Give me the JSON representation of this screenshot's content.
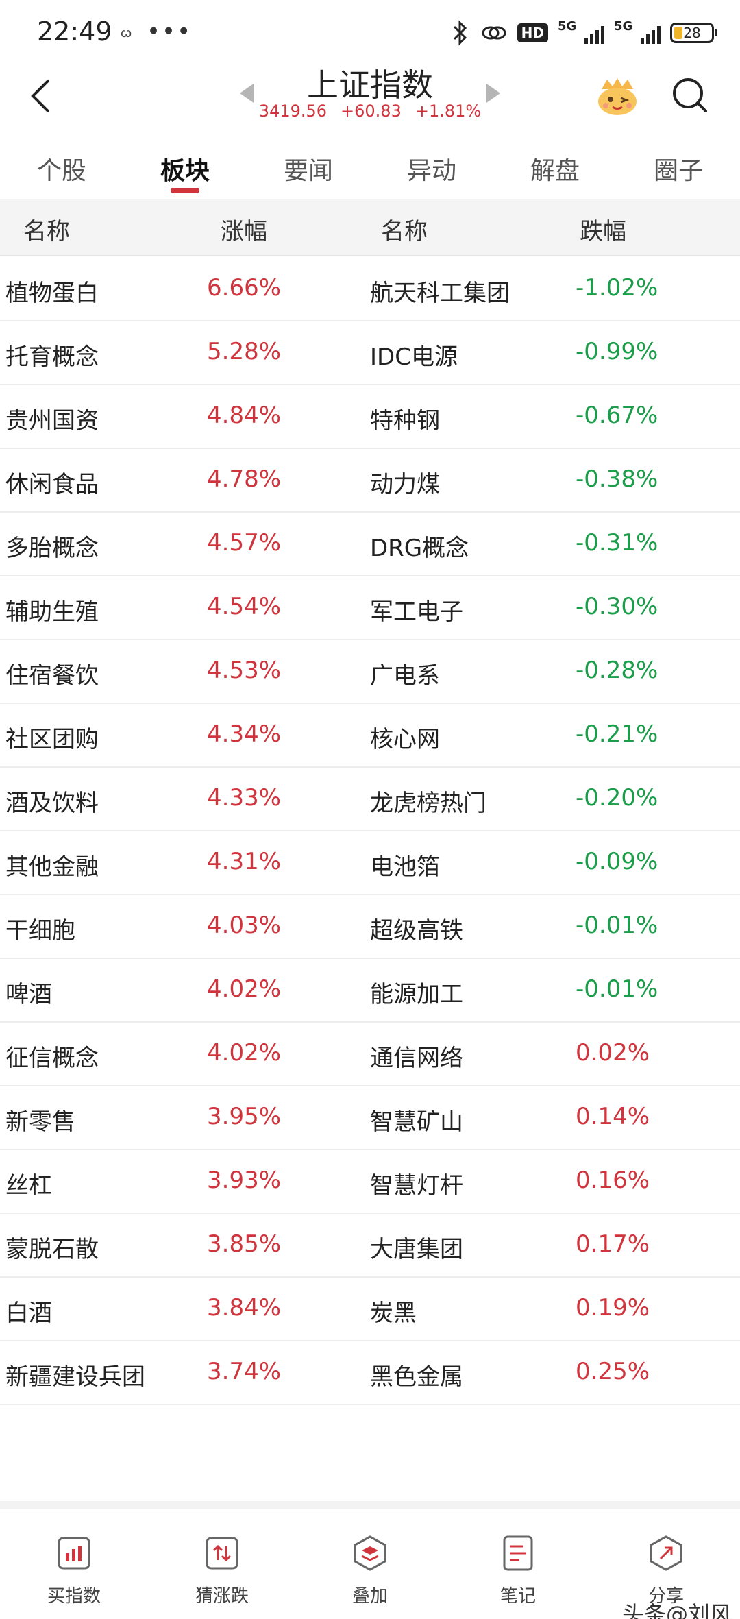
{
  "status_bar": {
    "time": "22:49",
    "small_icon": "ꞷ",
    "dots": "•••",
    "hd": "HD",
    "net1": "5G",
    "net2": "5G",
    "battery": "28"
  },
  "header": {
    "title": "上证指数",
    "price": "3419.56",
    "change": "+60.83",
    "change_pct": "+1.81%"
  },
  "tabs": [
    {
      "label": "个股"
    },
    {
      "label": "板块"
    },
    {
      "label": "要闻"
    },
    {
      "label": "异动"
    },
    {
      "label": "解盘"
    },
    {
      "label": "圈子"
    }
  ],
  "table": {
    "col_name_left": "名称",
    "col_rise": "涨幅",
    "col_name_right": "名称",
    "col_fall": "跌幅",
    "rows": [
      {
        "left_name": "植物蛋白",
        "left_pct": "6.66%",
        "right_name": "航天科工集团",
        "right_pct": "-1.02%",
        "right_dir": "down"
      },
      {
        "left_name": "托育概念",
        "left_pct": "5.28%",
        "right_name": "IDC电源",
        "right_pct": "-0.99%",
        "right_dir": "down"
      },
      {
        "left_name": "贵州国资",
        "left_pct": "4.84%",
        "right_name": "特种钢",
        "right_pct": "-0.67%",
        "right_dir": "down"
      },
      {
        "left_name": "休闲食品",
        "left_pct": "4.78%",
        "right_name": "动力煤",
        "right_pct": "-0.38%",
        "right_dir": "down"
      },
      {
        "left_name": "多胎概念",
        "left_pct": "4.57%",
        "right_name": "DRG概念",
        "right_pct": "-0.31%",
        "right_dir": "down"
      },
      {
        "left_name": "辅助生殖",
        "left_pct": "4.54%",
        "right_name": "军工电子",
        "right_pct": "-0.30%",
        "right_dir": "down"
      },
      {
        "left_name": "住宿餐饮",
        "left_pct": "4.53%",
        "right_name": "广电系",
        "right_pct": "-0.28%",
        "right_dir": "down"
      },
      {
        "left_name": "社区团购",
        "left_pct": "4.34%",
        "right_name": "核心网",
        "right_pct": "-0.21%",
        "right_dir": "down"
      },
      {
        "left_name": "酒及饮料",
        "left_pct": "4.33%",
        "right_name": "龙虎榜热门",
        "right_pct": "-0.20%",
        "right_dir": "down"
      },
      {
        "left_name": "其他金融",
        "left_pct": "4.31%",
        "right_name": "电池箔",
        "right_pct": "-0.09%",
        "right_dir": "down"
      },
      {
        "left_name": "干细胞",
        "left_pct": "4.03%",
        "right_name": "超级高铁",
        "right_pct": "-0.01%",
        "right_dir": "down"
      },
      {
        "left_name": "啤酒",
        "left_pct": "4.02%",
        "right_name": "能源加工",
        "right_pct": "-0.01%",
        "right_dir": "down"
      },
      {
        "left_name": "征信概念",
        "left_pct": "4.02%",
        "right_name": "通信网络",
        "right_pct": "0.02%",
        "right_dir": "up"
      },
      {
        "left_name": "新零售",
        "left_pct": "3.95%",
        "right_name": "智慧矿山",
        "right_pct": "0.14%",
        "right_dir": "up"
      },
      {
        "left_name": "丝杠",
        "left_pct": "3.93%",
        "right_name": "智慧灯杆",
        "right_pct": "0.16%",
        "right_dir": "up"
      },
      {
        "left_name": "蒙脱石散",
        "left_pct": "3.85%",
        "right_name": "大唐集团",
        "right_pct": "0.17%",
        "right_dir": "up"
      },
      {
        "left_name": "白酒",
        "left_pct": "3.84%",
        "right_name": "炭黑",
        "right_pct": "0.19%",
        "right_dir": "up"
      },
      {
        "left_name": "新疆建设兵团",
        "left_pct": "3.74%",
        "right_name": "黑色金属",
        "right_pct": "0.25%",
        "right_dir": "up"
      }
    ]
  },
  "bottom_nav": [
    {
      "label": "买指数",
      "icon": "bar-chart-icon"
    },
    {
      "label": "猜涨跌",
      "icon": "up-down-arrows-icon"
    },
    {
      "label": "叠加",
      "icon": "layers-icon"
    },
    {
      "label": "笔记",
      "icon": "note-icon"
    },
    {
      "label": "分享",
      "icon": "share-icon"
    }
  ],
  "watermark": "头条@刘风",
  "colors": {
    "up": "#d0353e",
    "down": "#1a9e4a",
    "accent": "#d0353e"
  }
}
